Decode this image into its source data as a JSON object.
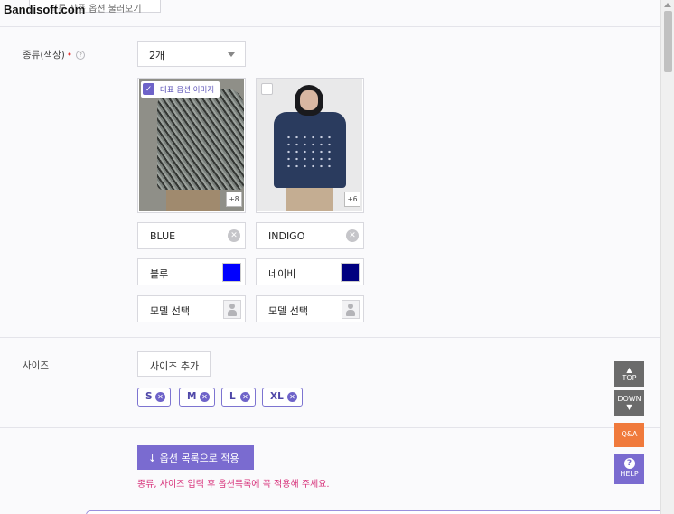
{
  "watermark": "Bandisoft.com",
  "top_button": "다른 상품 옵션 불러오기",
  "color_section": {
    "label": "종류(색상)",
    "required_mark": "•",
    "help_icon": "?",
    "count_select": "2개",
    "representative_badge": "대표 옵션 이미지",
    "options": [
      {
        "name": "BLUE",
        "display_name": "블루",
        "swatch": "#0000ff",
        "image_count": "+8",
        "model_placeholder": "모델 선택",
        "representative": true
      },
      {
        "name": "INDIGO",
        "display_name": "네이비",
        "swatch": "#000080",
        "image_count": "+6",
        "model_placeholder": "모델 선택",
        "representative": false
      }
    ]
  },
  "size_section": {
    "label": "사이즈",
    "add_button": "사이즈 추가",
    "sizes": [
      "S",
      "M",
      "L",
      "XL"
    ]
  },
  "apply_button": "↓ 옵션 목록으로 적용",
  "hint": "종류, 사이즈 입력 후 옵션목록에 꼭 적용해 주세요.",
  "floating": {
    "top": "TOP",
    "down": "DOWN",
    "qa": "Q&A",
    "help": "HELP"
  }
}
